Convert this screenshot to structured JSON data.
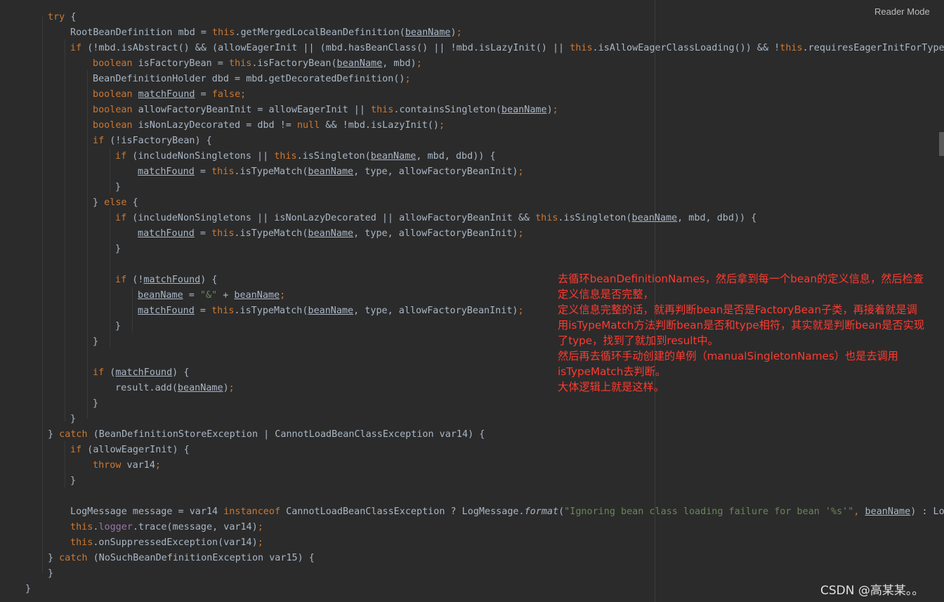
{
  "toolbar": {
    "reader_mode_label": "Reader Mode"
  },
  "code": {
    "lines": [
      [
        {
          "t": "try",
          "c": "kw"
        },
        {
          "t": " {",
          "c": "plain"
        }
      ],
      [
        {
          "t": "RootBeanDefinition mbd = ",
          "c": "plain"
        },
        {
          "t": "this",
          "c": "kw"
        },
        {
          "t": ".getMergedLocalBeanDefinition(",
          "c": "plain"
        },
        {
          "t": "beanName",
          "c": "ul"
        },
        {
          "t": ")",
          "c": "plain"
        },
        {
          "t": ";",
          "c": "kw"
        }
      ],
      [
        {
          "t": "if",
          "c": "kw"
        },
        {
          "t": " (!mbd.isAbstract() && (allowEagerInit || (mbd.hasBeanClass() || !mbd.isLazyInit() || ",
          "c": "plain"
        },
        {
          "t": "this",
          "c": "kw"
        },
        {
          "t": ".isAllowEagerClassLoading()) && !",
          "c": "plain"
        },
        {
          "t": "this",
          "c": "kw"
        },
        {
          "t": ".requiresEagerInitForType(m",
          "c": "plain"
        }
      ],
      [
        {
          "t": "boolean",
          "c": "kw"
        },
        {
          "t": " isFactoryBean = ",
          "c": "plain"
        },
        {
          "t": "this",
          "c": "kw"
        },
        {
          "t": ".isFactoryBean(",
          "c": "plain"
        },
        {
          "t": "beanName",
          "c": "ul"
        },
        {
          "t": ", mbd)",
          "c": "plain"
        },
        {
          "t": ";",
          "c": "kw"
        }
      ],
      [
        {
          "t": "BeanDefinitionHolder dbd = mbd.getDecoratedDefinition()",
          "c": "plain"
        },
        {
          "t": ";",
          "c": "kw"
        }
      ],
      [
        {
          "t": "boolean",
          "c": "kw"
        },
        {
          "t": " ",
          "c": "plain"
        },
        {
          "t": "matchFound",
          "c": "ul"
        },
        {
          "t": " = ",
          "c": "plain"
        },
        {
          "t": "false;",
          "c": "kw"
        }
      ],
      [
        {
          "t": "boolean",
          "c": "kw"
        },
        {
          "t": " allowFactoryBeanInit = allowEagerInit || ",
          "c": "plain"
        },
        {
          "t": "this",
          "c": "kw"
        },
        {
          "t": ".containsSingleton(",
          "c": "plain"
        },
        {
          "t": "beanName",
          "c": "ul"
        },
        {
          "t": ")",
          "c": "plain"
        },
        {
          "t": ";",
          "c": "kw"
        }
      ],
      [
        {
          "t": "boolean",
          "c": "kw"
        },
        {
          "t": " isNonLazyDecorated = dbd != ",
          "c": "plain"
        },
        {
          "t": "null",
          "c": "kw"
        },
        {
          "t": " && !mbd.isLazyInit()",
          "c": "plain"
        },
        {
          "t": ";",
          "c": "kw"
        }
      ],
      [
        {
          "t": "if",
          "c": "kw"
        },
        {
          "t": " (!isFactoryBean) {",
          "c": "plain"
        }
      ],
      [
        {
          "t": "if",
          "c": "kw"
        },
        {
          "t": " (includeNonSingletons || ",
          "c": "plain"
        },
        {
          "t": "this",
          "c": "kw"
        },
        {
          "t": ".isSingleton(",
          "c": "plain"
        },
        {
          "t": "beanName",
          "c": "ul"
        },
        {
          "t": ", mbd, dbd)) {",
          "c": "plain"
        }
      ],
      [
        {
          "t": "matchFound",
          "c": "ul"
        },
        {
          "t": " = ",
          "c": "plain"
        },
        {
          "t": "this",
          "c": "kw"
        },
        {
          "t": ".isTypeMatch(",
          "c": "plain"
        },
        {
          "t": "beanName",
          "c": "ul"
        },
        {
          "t": ", type, allowFactoryBeanInit)",
          "c": "plain"
        },
        {
          "t": ";",
          "c": "kw"
        }
      ],
      [
        {
          "t": "}",
          "c": "plain"
        }
      ],
      [
        {
          "t": "} ",
          "c": "plain"
        },
        {
          "t": "else",
          "c": "kw"
        },
        {
          "t": " {",
          "c": "plain"
        }
      ],
      [
        {
          "t": "if",
          "c": "kw"
        },
        {
          "t": " (includeNonSingletons || isNonLazyDecorated || allowFactoryBeanInit && ",
          "c": "plain"
        },
        {
          "t": "this",
          "c": "kw"
        },
        {
          "t": ".isSingleton(",
          "c": "plain"
        },
        {
          "t": "beanName",
          "c": "ul"
        },
        {
          "t": ", mbd, dbd)) {",
          "c": "plain"
        }
      ],
      [
        {
          "t": "matchFound",
          "c": "ul"
        },
        {
          "t": " = ",
          "c": "plain"
        },
        {
          "t": "this",
          "c": "kw"
        },
        {
          "t": ".isTypeMatch(",
          "c": "plain"
        },
        {
          "t": "beanName",
          "c": "ul"
        },
        {
          "t": ", type, allowFactoryBeanInit)",
          "c": "plain"
        },
        {
          "t": ";",
          "c": "kw"
        }
      ],
      [
        {
          "t": "}",
          "c": "plain"
        }
      ],
      [],
      [
        {
          "t": "if",
          "c": "kw"
        },
        {
          "t": " (!",
          "c": "plain"
        },
        {
          "t": "matchFound",
          "c": "ul"
        },
        {
          "t": ") {",
          "c": "plain"
        }
      ],
      [
        {
          "t": "beanName",
          "c": "ul"
        },
        {
          "t": " = ",
          "c": "plain"
        },
        {
          "t": "\"&\"",
          "c": "str"
        },
        {
          "t": " + ",
          "c": "plain"
        },
        {
          "t": "beanName",
          "c": "ul"
        },
        {
          "t": ";",
          "c": "kw"
        }
      ],
      [
        {
          "t": "matchFound",
          "c": "ul"
        },
        {
          "t": " = ",
          "c": "plain"
        },
        {
          "t": "this",
          "c": "kw"
        },
        {
          "t": ".isTypeMatch(",
          "c": "plain"
        },
        {
          "t": "beanName",
          "c": "ul"
        },
        {
          "t": ", type, allowFactoryBeanInit)",
          "c": "plain"
        },
        {
          "t": ";",
          "c": "kw"
        }
      ],
      [
        {
          "t": "}",
          "c": "plain"
        }
      ],
      [
        {
          "t": "}",
          "c": "plain"
        }
      ],
      [],
      [
        {
          "t": "if",
          "c": "kw"
        },
        {
          "t": " (",
          "c": "plain"
        },
        {
          "t": "matchFound",
          "c": "ul"
        },
        {
          "t": ") {",
          "c": "plain"
        }
      ],
      [
        {
          "t": "result.add(",
          "c": "plain"
        },
        {
          "t": "beanName",
          "c": "ul"
        },
        {
          "t": ")",
          "c": "plain"
        },
        {
          "t": ";",
          "c": "kw"
        }
      ],
      [
        {
          "t": "}",
          "c": "plain"
        }
      ],
      [
        {
          "t": "}",
          "c": "plain"
        }
      ],
      [
        {
          "t": "} ",
          "c": "plain"
        },
        {
          "t": "catch",
          "c": "kw"
        },
        {
          "t": " (BeanDefinitionStoreException | CannotLoadBeanClassException var14) {",
          "c": "plain"
        }
      ],
      [
        {
          "t": "if",
          "c": "kw"
        },
        {
          "t": " (allowEagerInit) {",
          "c": "plain"
        }
      ],
      [
        {
          "t": "throw",
          "c": "kw"
        },
        {
          "t": " var14",
          "c": "plain"
        },
        {
          "t": ";",
          "c": "kw"
        }
      ],
      [
        {
          "t": "}",
          "c": "plain"
        }
      ],
      [],
      [
        {
          "t": "LogMessage message = var14 ",
          "c": "plain"
        },
        {
          "t": "instanceof",
          "c": "kw"
        },
        {
          "t": " CannotLoadBeanClassException ? LogMessage.",
          "c": "plain"
        },
        {
          "t": "format",
          "c": "it"
        },
        {
          "t": "(",
          "c": "plain"
        },
        {
          "t": "\"Ignoring bean class loading failure for bean '%s'\"",
          "c": "str"
        },
        {
          "t": ", ",
          "c": "kw"
        },
        {
          "t": "beanName",
          "c": "ul"
        },
        {
          "t": ") : LogM",
          "c": "plain"
        }
      ],
      [
        {
          "t": "this",
          "c": "kw"
        },
        {
          "t": ".",
          "c": "plain"
        },
        {
          "t": "logger",
          "c": "field"
        },
        {
          "t": ".trace(message, var14)",
          "c": "plain"
        },
        {
          "t": ";",
          "c": "kw"
        }
      ],
      [
        {
          "t": "this",
          "c": "kw"
        },
        {
          "t": ".onSuppressedException(var14)",
          "c": "plain"
        },
        {
          "t": ";",
          "c": "kw"
        }
      ],
      [
        {
          "t": "} ",
          "c": "plain"
        },
        {
          "t": "catch",
          "c": "kw"
        },
        {
          "t": " (NoSuchBeanDefinitionException var15) {",
          "c": "plain"
        }
      ],
      [
        {
          "t": "}",
          "c": "plain"
        }
      ],
      [
        {
          "t": "}",
          "c": "plain"
        }
      ]
    ]
  },
  "annotation": {
    "lines": [
      "去循环beanDefinitionNames，然后拿到每一个bean的定义信息，然后检查",
      "定义信息是否完整，",
      "定义信息完整的话，就再判断bean是否是FactoryBean子类，再接着就是调",
      "用isTypeMatch方法判断bean是否和type相符，其实就是判断bean是否实现",
      "了type，找到了就加到result中。",
      "然后再去循环手动创建的单例（manualSingletonNames）也是去调用",
      "isTypeMatch去判断。",
      "大体逻辑上就是这样。"
    ]
  },
  "watermark": {
    "text": "CSDN @高某某。。"
  }
}
